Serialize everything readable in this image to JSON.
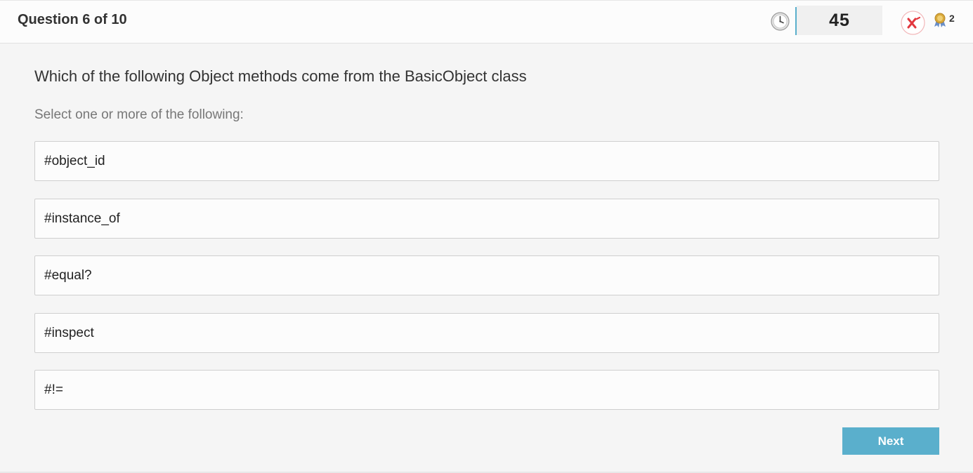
{
  "header": {
    "question_counter": "Question 6 of 10",
    "timer_value": "45",
    "badge_count": "2",
    "icons": {
      "clock": "clock-icon",
      "quit": "quit-icon",
      "badge": "award-badge-icon"
    }
  },
  "question": {
    "text": "Which of the following Object methods come from the BasicObject class",
    "instruction": "Select one or more of the following:",
    "options": [
      {
        "label": "#object_id"
      },
      {
        "label": "#instance_of"
      },
      {
        "label": "#equal?"
      },
      {
        "label": "#inspect"
      },
      {
        "label": "#!="
      }
    ]
  },
  "footer": {
    "next_label": "Next"
  },
  "colors": {
    "accent": "#5aafcc",
    "quit_red": "#e2383f",
    "badge_gold": "#d9a93a",
    "badge_blue": "#6a8fc8"
  }
}
